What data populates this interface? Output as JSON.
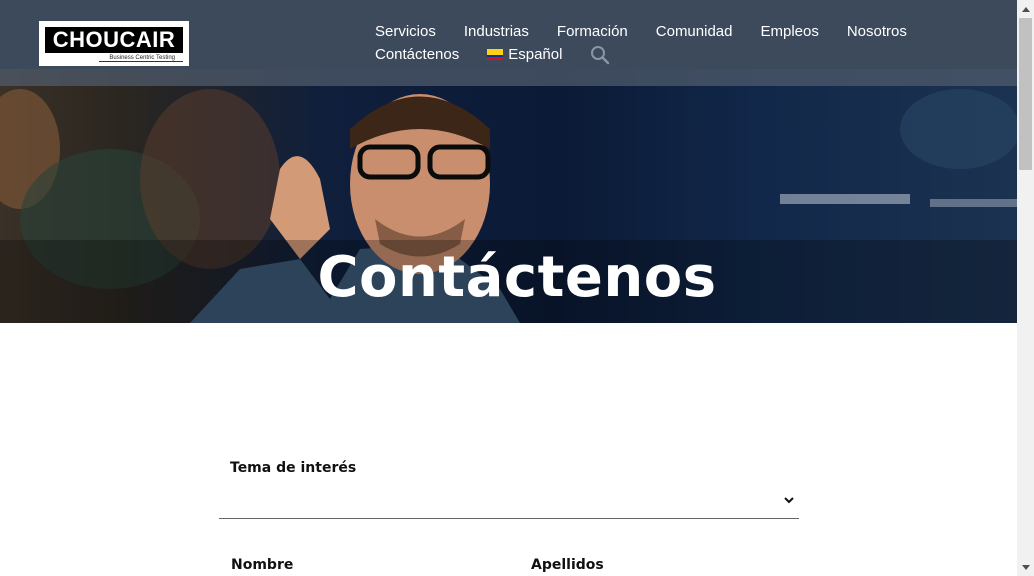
{
  "brand": {
    "name": "CHOUCAIR",
    "tagline": "Business Centric Testing"
  },
  "nav": {
    "row1": [
      "Servicios",
      "Industrias",
      "Formación",
      "Comunidad",
      "Empleos",
      "Nosotros"
    ],
    "contact": "Contáctenos",
    "language": "Español",
    "language_flag": "colombia-flag-icon",
    "search_icon": "search-icon"
  },
  "hero": {
    "title": "Contáctenos"
  },
  "form": {
    "topic_label": "Tema de interés",
    "topic_value": "",
    "first_name_label": "Nombre",
    "last_name_label": "Apellidos"
  },
  "colors": {
    "header_bg": "#3c4a5c",
    "hero_bg": "#0b1a36",
    "text": "#111111"
  }
}
